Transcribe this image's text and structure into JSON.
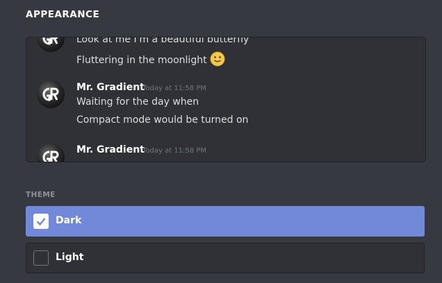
{
  "section": {
    "title": "APPEARANCE"
  },
  "preview": {
    "messages": [
      {
        "line": "Look at me I'm a beautiful butterfly"
      },
      {
        "line": "Fluttering in the moonlight",
        "emoji": "slightly-smiling-face-icon"
      },
      {
        "username": "Mr. Gradient",
        "timestamp": "Today at 11:58 PM",
        "lines": [
          "Waiting for the day when",
          "Compact mode would be turned on"
        ]
      },
      {
        "username": "Mr. Gradient",
        "timestamp": "Today at 11:58 PM"
      }
    ]
  },
  "theme": {
    "label": "THEME",
    "options": [
      {
        "label": "Dark",
        "selected": true
      },
      {
        "label": "Light",
        "selected": false
      }
    ]
  },
  "colors": {
    "background": "#36393f",
    "preview_bg": "#2f3136",
    "accent": "#7289da",
    "muted": "#72767d"
  }
}
